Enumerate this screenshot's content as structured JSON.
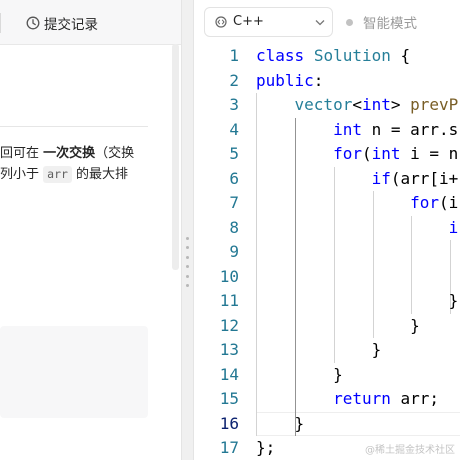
{
  "left_panel": {
    "submit_tab_label": "提交记录",
    "description": {
      "line1": {
        "t1": "回可在 ",
        "bold": "一次交换",
        "t2": "（交换"
      },
      "line2": {
        "t1": "列小于 ",
        "code": "arr",
        "t2": " 的最大排"
      }
    }
  },
  "editor": {
    "language": "C++",
    "smart_mode_label": "智能模式",
    "current_line": 16,
    "code_lines": [
      {
        "n": "1",
        "tokens": [
          [
            "k",
            "class"
          ],
          [
            "p",
            " "
          ],
          [
            "t",
            "Solution"
          ],
          [
            "p",
            " {"
          ]
        ]
      },
      {
        "n": "2",
        "tokens": [
          [
            "k",
            "public"
          ],
          [
            "p",
            ":"
          ]
        ]
      },
      {
        "n": "3",
        "tokens": [
          [
            "p",
            "    "
          ],
          [
            "t",
            "vector"
          ],
          [
            "p",
            "<"
          ],
          [
            "k",
            "int"
          ],
          [
            "p",
            "> "
          ],
          [
            "f",
            "prevP"
          ]
        ]
      },
      {
        "n": "4",
        "tokens": [
          [
            "p",
            "        "
          ],
          [
            "k",
            "int"
          ],
          [
            "p",
            " n = arr.s"
          ]
        ]
      },
      {
        "n": "5",
        "tokens": [
          [
            "p",
            "        "
          ],
          [
            "k",
            "for"
          ],
          [
            "p",
            "("
          ],
          [
            "k",
            "int"
          ],
          [
            "p",
            " i = n"
          ]
        ]
      },
      {
        "n": "6",
        "tokens": [
          [
            "p",
            "            "
          ],
          [
            "k",
            "if"
          ],
          [
            "p",
            "(arr[i+"
          ]
        ]
      },
      {
        "n": "7",
        "tokens": [
          [
            "p",
            "                "
          ],
          [
            "k",
            "for"
          ],
          [
            "p",
            "(i"
          ]
        ]
      },
      {
        "n": "8",
        "tokens": [
          [
            "p",
            "                    "
          ],
          [
            "k",
            "i"
          ]
        ]
      },
      {
        "n": "9",
        "tokens": []
      },
      {
        "n": "10",
        "tokens": []
      },
      {
        "n": "11",
        "tokens": [
          [
            "p",
            "                    }"
          ]
        ]
      },
      {
        "n": "12",
        "tokens": [
          [
            "p",
            "                }"
          ]
        ]
      },
      {
        "n": "13",
        "tokens": [
          [
            "p",
            "            }"
          ]
        ]
      },
      {
        "n": "14",
        "tokens": [
          [
            "p",
            "        }"
          ]
        ]
      },
      {
        "n": "15",
        "tokens": [
          [
            "p",
            "        "
          ],
          [
            "k",
            "return"
          ],
          [
            "p",
            " arr;"
          ]
        ]
      },
      {
        "n": "16",
        "tokens": [
          [
            "p",
            "    }"
          ]
        ]
      },
      {
        "n": "17",
        "tokens": [
          [
            "p",
            "};"
          ]
        ]
      }
    ]
  },
  "watermark": "@稀土掘金技术社区",
  "icons": {
    "history": "history-icon",
    "code": "code-icon",
    "chevron": "chevron-down-icon",
    "grip": "drag-handle-icon"
  }
}
